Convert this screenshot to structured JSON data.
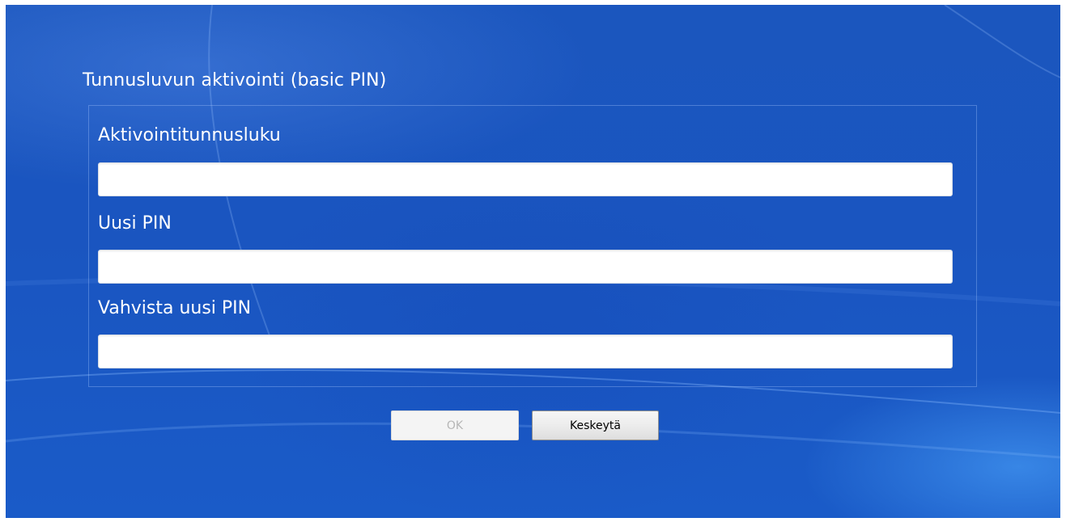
{
  "dialog": {
    "title": "Tunnusluvun aktivointi (basic PIN)",
    "fields": [
      {
        "label": "Aktivointitunnusluku",
        "value": ""
      },
      {
        "label": "Uusi PIN",
        "value": ""
      },
      {
        "label": "Vahvista uusi PIN",
        "value": ""
      }
    ],
    "buttons": {
      "ok_label": "OK",
      "cancel_label": "Keskeytä"
    }
  },
  "colors": {
    "background": "#1b56be",
    "text": "#ffffff",
    "input_background": "#ffffff",
    "ok_disabled_text": "#b6b6b6"
  }
}
